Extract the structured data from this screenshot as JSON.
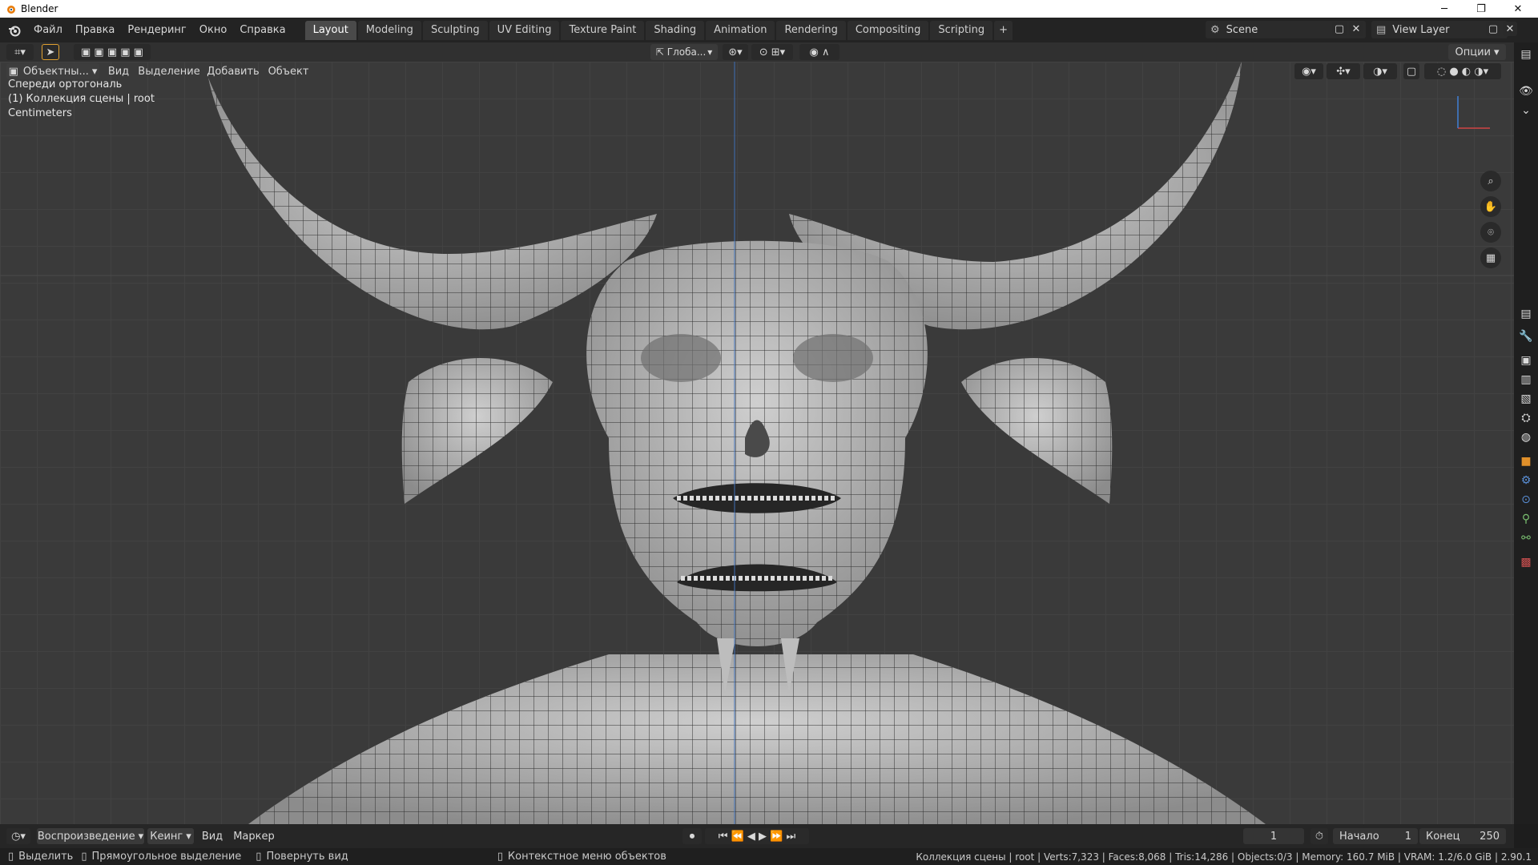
{
  "window": {
    "title": "Blender",
    "min": "─",
    "max": "❐",
    "close": "✕"
  },
  "menu": [
    "Файл",
    "Правка",
    "Рендеринг",
    "Окно",
    "Справка"
  ],
  "workspaces": [
    {
      "label": "Layout",
      "active": true
    },
    {
      "label": "Modeling"
    },
    {
      "label": "Sculpting"
    },
    {
      "label": "UV Editing"
    },
    {
      "label": "Texture Paint"
    },
    {
      "label": "Shading"
    },
    {
      "label": "Animation"
    },
    {
      "label": "Rendering"
    },
    {
      "label": "Compositing"
    },
    {
      "label": "Scripting"
    }
  ],
  "add_workspace": "+",
  "scene": {
    "label": "Scene",
    "view_layer": "View Layer"
  },
  "header": {
    "transform_orientation": "Глоба...",
    "options": "Опции"
  },
  "viewport": {
    "mode": "Объектны...",
    "menu": [
      "Вид",
      "Выделение",
      "Добавить",
      "Объект"
    ],
    "overlay_lines": [
      "Спереди ортогональ",
      "(1) Коллекция сцены | root",
      "Centimeters"
    ]
  },
  "timeline": {
    "playback": "Воспроизведение",
    "keying": "Кеинг",
    "view": "Вид",
    "marker": "Маркер",
    "current_frame": "1",
    "start_label": "Начало",
    "start": "1",
    "end_label": "Конец",
    "end": "250"
  },
  "status": {
    "select": "Выделить",
    "box_select": "Прямоугольное выделение",
    "rotate": "Повернуть вид",
    "context": "Контекстное меню объектов",
    "stats": "Коллекция сцены | root | Verts:7,323 | Faces:8,068 | Tris:14,286 | Objects:0/3 | Memory: 160.7 MiB | VRAM: 1.2/6.0 GiB | 2.90.1"
  },
  "colors": {
    "accent": "#5680c2",
    "mesh": "#b5b5b5",
    "wire": "#2a2a2a"
  }
}
